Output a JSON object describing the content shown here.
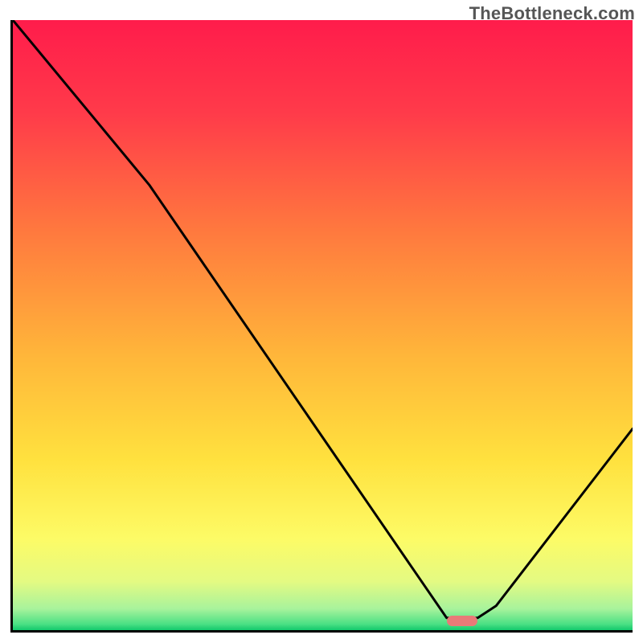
{
  "watermark": "TheBottleneck.com",
  "chart_data": {
    "type": "line",
    "title": "",
    "xlabel": "",
    "ylabel": "",
    "xlim": [
      0,
      100
    ],
    "ylim": [
      0,
      100
    ],
    "grid": false,
    "legend": false,
    "series": [
      {
        "name": "bottleneck-curve",
        "x": [
          0,
          22,
          70,
          75,
          78,
          100
        ],
        "values": [
          100,
          73,
          2,
          2,
          4,
          33
        ]
      }
    ],
    "marker": {
      "name": "optimal-point",
      "x_center": 72.5,
      "y_center": 1.5,
      "width_pct": 5,
      "height_pct": 1.8,
      "color": "#e87a78"
    },
    "gradient_stops": [
      {
        "offset": 0,
        "color": "#ff1c4b"
      },
      {
        "offset": 0.15,
        "color": "#ff3a4a"
      },
      {
        "offset": 0.35,
        "color": "#ff7a3e"
      },
      {
        "offset": 0.55,
        "color": "#ffb63a"
      },
      {
        "offset": 0.72,
        "color": "#ffe13e"
      },
      {
        "offset": 0.85,
        "color": "#fdfb66"
      },
      {
        "offset": 0.92,
        "color": "#e4fa82"
      },
      {
        "offset": 0.965,
        "color": "#a8f39c"
      },
      {
        "offset": 0.99,
        "color": "#4be084"
      },
      {
        "offset": 1.0,
        "color": "#12c86c"
      }
    ]
  },
  "plot": {
    "inner_w": 771,
    "inner_h": 759
  }
}
